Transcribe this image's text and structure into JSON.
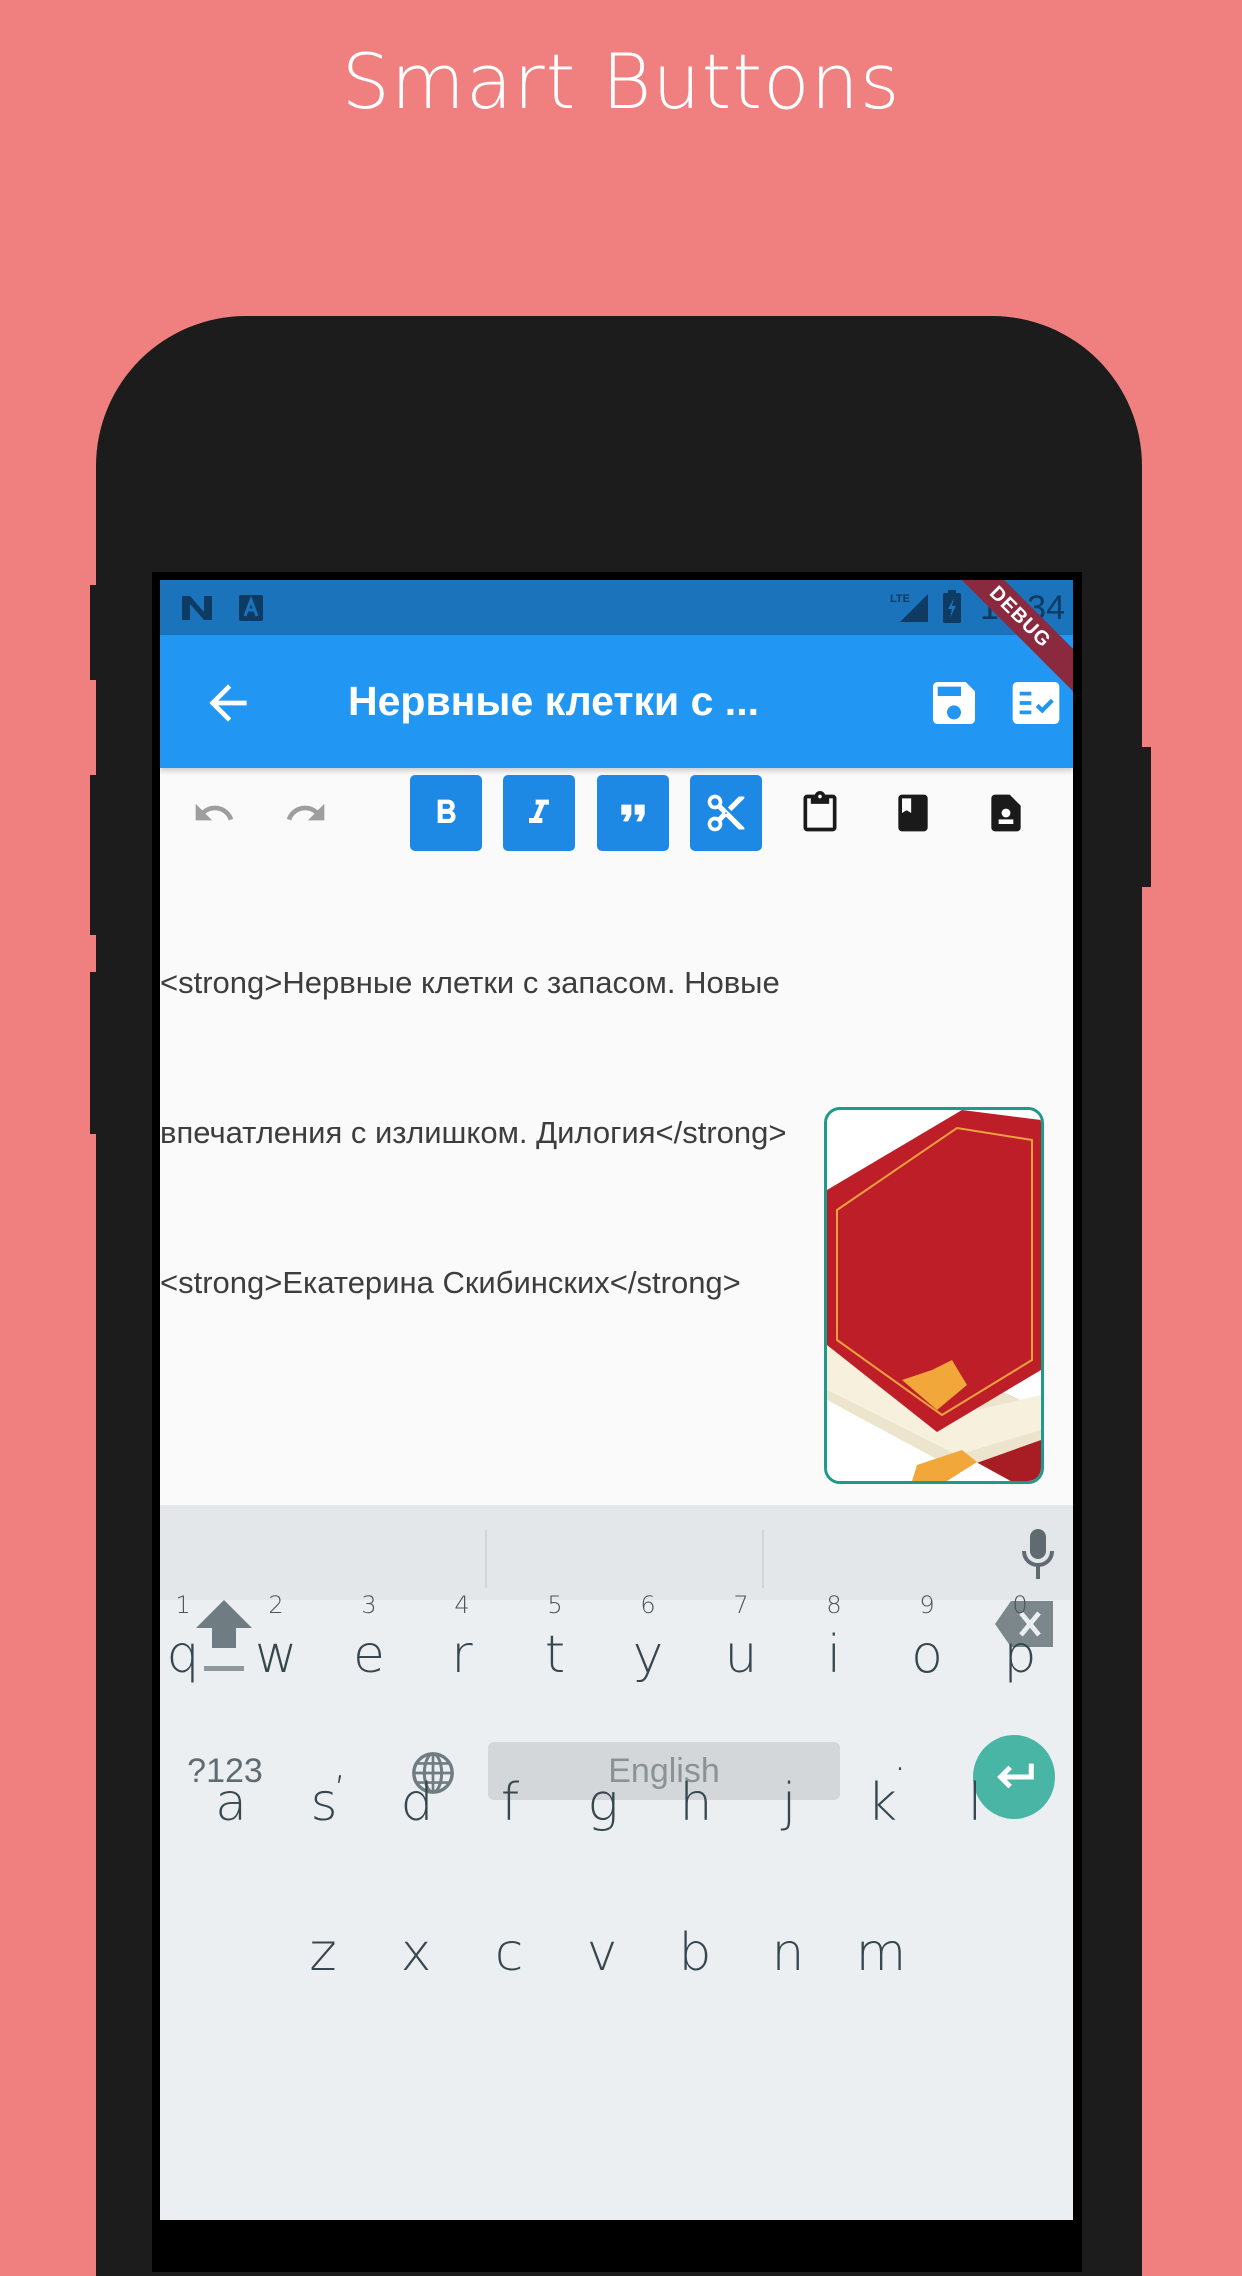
{
  "promo": {
    "title": "Smart Buttons"
  },
  "status_bar": {
    "left_icons": [
      "n-notification-icon",
      "a-notification-icon"
    ],
    "network": "LTE",
    "time": "10:34",
    "debug_banner": "DEBUG"
  },
  "app_bar": {
    "back_icon": "arrow-left-icon",
    "title": "Нервные клетки с ...",
    "actions": [
      "save-icon",
      "checklist-icon"
    ],
    "colors": {
      "app_bar": "#2196f3",
      "status_bar": "#1a73bb"
    }
  },
  "toolbar": {
    "buttons": [
      {
        "name": "undo",
        "icon": "undo-icon",
        "active": false
      },
      {
        "name": "redo",
        "icon": "redo-icon",
        "active": false
      },
      {
        "name": "bold",
        "label": "B",
        "icon": "bold-icon",
        "active": true
      },
      {
        "name": "italic",
        "label": "I",
        "icon": "italic-icon",
        "active": true
      },
      {
        "name": "quote",
        "label": "”",
        "icon": "quote-icon",
        "active": true
      },
      {
        "name": "cut",
        "icon": "scissors-icon",
        "active": true
      },
      {
        "name": "paste",
        "icon": "clipboard-icon",
        "active": false
      },
      {
        "name": "book",
        "icon": "book-icon",
        "active": false
      },
      {
        "name": "contact-file",
        "icon": "contact-file-icon",
        "active": false
      }
    ],
    "active_color": "#1e88e5"
  },
  "editor": {
    "lines": [
      "<strong>Нервные клетки с запасом. Новые",
      "впечатления с излишком. Дилогия</strong>",
      "<strong>Екатерина Скибинских</strong>"
    ],
    "cover_image": "red-book-cover"
  },
  "keyboard": {
    "row1": [
      "q",
      "w",
      "e",
      "r",
      "t",
      "y",
      "u",
      "i",
      "o",
      "p"
    ],
    "row1_hints": [
      "1",
      "2",
      "3",
      "4",
      "5",
      "6",
      "7",
      "8",
      "9",
      "0"
    ],
    "row2": [
      "a",
      "s",
      "d",
      "f",
      "g",
      "h",
      "j",
      "k",
      "l"
    ],
    "row3": [
      "z",
      "x",
      "c",
      "v",
      "b",
      "n",
      "m"
    ],
    "symbols_label": "?123",
    "comma": ",",
    "period": ".",
    "space_label": "English",
    "enter_color": "#48b5a5"
  }
}
